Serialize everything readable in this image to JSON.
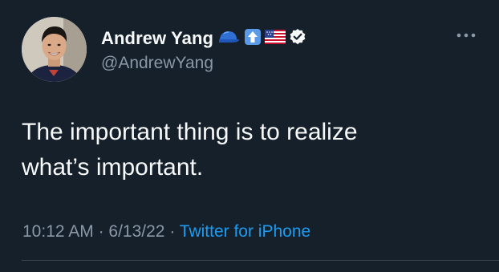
{
  "author": {
    "display_name": "Andrew Yang",
    "handle": "@AndrewYang",
    "name_emojis": [
      "blue-cap-icon",
      "up-arrow-icon",
      "us-flag-icon",
      "verified-badge-icon"
    ]
  },
  "tweet": {
    "text": "The important thing is to realize\nwhat’s important."
  },
  "meta": {
    "time": "10:12 AM",
    "separator_1": " · ",
    "date": "6/13/22",
    "separator_2": " · ",
    "source": "Twitter for iPhone"
  },
  "colors": {
    "background": "#15202b",
    "primary_text": "#f7f9f9",
    "secondary_text": "#8b98a5",
    "link": "#1d9bf0",
    "divider": "#38444d"
  }
}
